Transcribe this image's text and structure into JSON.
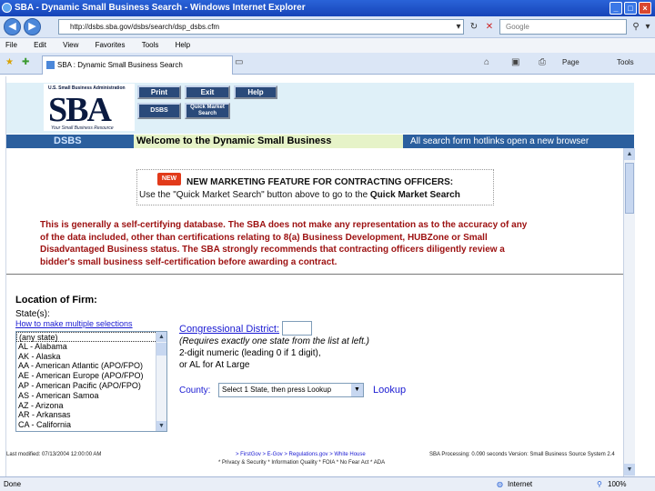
{
  "window": {
    "title": "SBA - Dynamic Small Business Search - Windows Internet Explorer"
  },
  "address_bar": {
    "url": "http://dsbs.sba.gov/dsbs/search/dsp_dsbs.cfm",
    "search_placeholder": "Google"
  },
  "menu": [
    "File",
    "Edit",
    "View",
    "Favorites",
    "Tools",
    "Help"
  ],
  "tab": {
    "label": "SBA : Dynamic Small Business Search"
  },
  "commands": {
    "page": "Page",
    "tools": "Tools"
  },
  "header": {
    "sba_top": "U.S. Small Business Administration",
    "sba_logo": "SBA",
    "sba_tagline": "Your Small Business Resource",
    "buttons": {
      "print": "Print",
      "exit": "Exit",
      "help": "Help",
      "dsbs": "DSBS",
      "quick_market": "Quick Market Search"
    }
  },
  "bluebar": {
    "dsbs": "DSBS",
    "welcome": "Welcome to the Dynamic Small Business",
    "note": "All search form hotlinks open a new browser"
  },
  "notice": {
    "badge": "NEW",
    "line1": "NEW MARKETING FEATURE FOR CONTRACTING OFFICERS:",
    "line2_prefix": "Use the \"Quick Market Search\" button above to go to the ",
    "line2_bold": "Quick Market Search"
  },
  "disclaimer": {
    "l1": "This is generally a self-certifying database. The SBA does not make any representation as to the accuracy of any",
    "l2": "of the data included, other than certifications relating to 8(a) Business Development, HUBZone or Small",
    "l3": "Disadvantaged Business status. The SBA strongly recommends that contracting officers diligently review a",
    "l4": "bidder's small business self-certification before awarding a contract."
  },
  "location": {
    "title": "Location of Firm:",
    "states_label": "State(s):",
    "howto": "How to make multiple selections",
    "states": [
      "(any state)",
      "AL - Alabama",
      "AK - Alaska",
      "AA - American Atlantic (APO/FPO)",
      "AE - American Europe (APO/FPO)",
      "AP - American Pacific (APO/FPO)",
      "AS - American Samoa",
      "AZ - Arizona",
      "AR - Arkansas",
      "CA - California"
    ],
    "congressional_label": "Congressional District:",
    "congressional_value": "",
    "cong_note1": "(Requires exactly one state from the list at left.)",
    "cong_note2": "2-digit numeric (leading 0 if 1 digit),",
    "cong_note3": "or AL for At Large",
    "county_label": "County:",
    "county_value": "Select 1 State, then press Lookup",
    "lookup": "Lookup"
  },
  "footer": {
    "last_modified": "Last modified: 07/13/2004 12:00:00 AM",
    "links": "> FirstGov   > E-Gov   > Regulations.gov   > White House",
    "processing": "SBA Processing: 0.090 seconds Version: Small Business Source System 2.4",
    "line2": "* Privacy & Security  * Information Quality  * FOIA  * No Fear Act  * ADA"
  },
  "status": {
    "left": "Done",
    "zone": "Internet",
    "zoom": "100%"
  }
}
